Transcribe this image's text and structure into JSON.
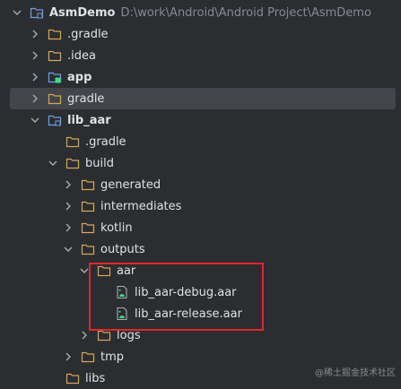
{
  "tree": {
    "root": {
      "label": "AsmDemo",
      "path": "D:\\work\\Android\\Android Project\\AsmDemo"
    },
    "items": [
      {
        "label": ".gradle"
      },
      {
        "label": ".idea"
      },
      {
        "label": "app"
      },
      {
        "label": "gradle"
      },
      {
        "label": "lib_aar"
      },
      {
        "label": ".gradle"
      },
      {
        "label": "build"
      },
      {
        "label": "generated"
      },
      {
        "label": "intermediates"
      },
      {
        "label": "kotlin"
      },
      {
        "label": "outputs"
      },
      {
        "label": "aar"
      },
      {
        "label": "lib_aar-debug.aar"
      },
      {
        "label": "lib_aar-release.aar"
      },
      {
        "label": "logs"
      },
      {
        "label": "tmp"
      },
      {
        "label": "libs"
      }
    ]
  },
  "watermark": "@稀土掘金技术社区",
  "colors": {
    "background": "#2b2d30",
    "selection": "#43454a",
    "folder": "#d6a55a",
    "module": "#6fa0e6",
    "highlight_box": "#e0262b",
    "android_green": "#3ddc84"
  }
}
